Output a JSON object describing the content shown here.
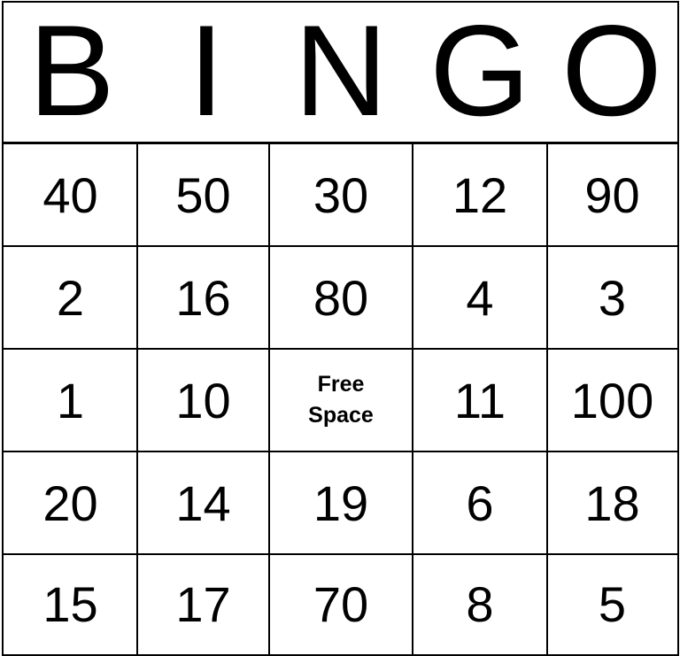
{
  "title_letters": [
    "B",
    "I",
    "N",
    "G",
    "O"
  ],
  "rows": [
    [
      "40",
      "50",
      "30",
      "12",
      "90"
    ],
    [
      "2",
      "16",
      "80",
      "4",
      "3"
    ],
    [
      "1",
      "10",
      "Free Space",
      "11",
      "100"
    ],
    [
      "20",
      "14",
      "19",
      "6",
      "18"
    ],
    [
      "15",
      "17",
      "70",
      "8",
      "5"
    ]
  ],
  "free_space": {
    "line1": "Free",
    "line2": "Space"
  }
}
